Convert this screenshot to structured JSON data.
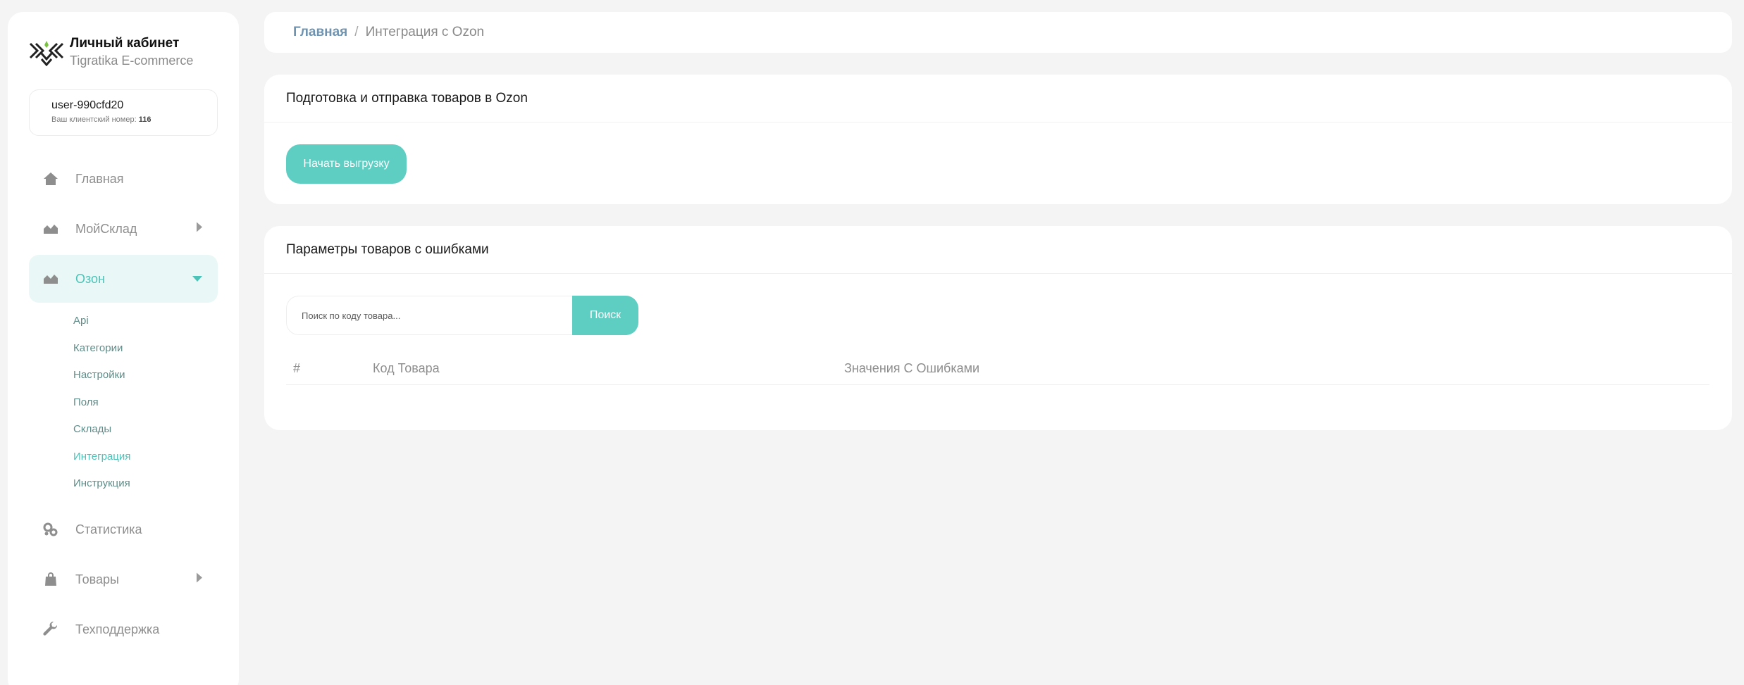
{
  "sidebar": {
    "brand": {
      "title": "Личный кабинет",
      "subtitle": "Tigratika E-commerce",
      "logo_icon": "tigratika-logo-icon"
    },
    "user": {
      "name": "user-990cfd20",
      "client_label": "Ваш клиентский номер:",
      "client_number": "116"
    },
    "nav": [
      {
        "label": "Главная",
        "icon": "home-icon"
      },
      {
        "label": "МойСклад",
        "icon": "chart-icon",
        "expandable": true,
        "expanded": false
      },
      {
        "label": "Озон",
        "icon": "chart-icon",
        "expandable": true,
        "expanded": true,
        "active": true
      },
      {
        "label": "Статистика",
        "icon": "cogs-icon"
      },
      {
        "label": "Товары",
        "icon": "bag-icon",
        "expandable": true,
        "expanded": false
      },
      {
        "label": "Техподдержка",
        "icon": "wrench-icon"
      }
    ],
    "ozon_sub": [
      "Api",
      "Категории",
      "Настройки",
      "Поля",
      "Склады",
      "Интеграция",
      "Инструкция"
    ],
    "ozon_sub_active": "Интеграция"
  },
  "breadcrumb": {
    "home": "Главная",
    "separator": "/",
    "current": "Интеграция с Ozon"
  },
  "upload_card": {
    "title": "Подготовка и отправка товаров в Ozon",
    "button": "Начать выгрузку"
  },
  "errors_card": {
    "title": "Параметры товаров с ошибками",
    "search_placeholder": "Поиск по коду товара...",
    "search_value": "",
    "search_button": "Поиск",
    "columns": [
      "#",
      "Код Товара",
      "Значения С Ошибками"
    ],
    "rows": []
  },
  "colors": {
    "accent": "#5ecdc2",
    "accent_text": "#4cc3b8",
    "active_bg": "#e9f8f6",
    "breadcrumb_link": "#6d93b1",
    "background": "#f4f4f4"
  }
}
